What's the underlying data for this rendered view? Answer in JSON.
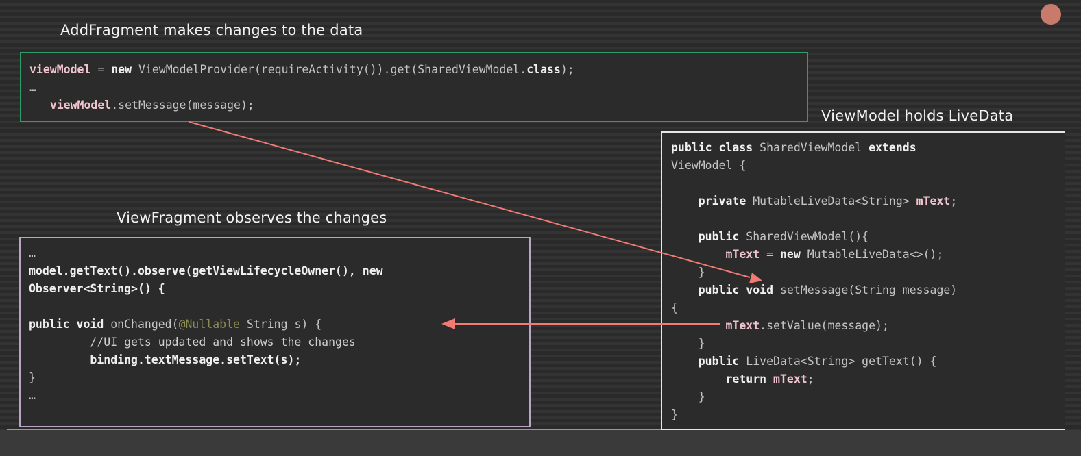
{
  "captions": {
    "add": "AddFragment makes changes to the data",
    "viewmodel": "ViewModel holds LiveData",
    "view": "ViewFragment observes the changes"
  },
  "colors": {
    "add_box_border": "#2e9e68",
    "view_box_border": "#b9a6c4",
    "vm_box_border": "#e6e6e6",
    "arrow": "#f07a74",
    "identifier": "#f2c4cf",
    "annotation": "#8b8b52",
    "corner_mark": "#c97b6b"
  },
  "icons": {
    "arrow_head": "arrowhead-icon",
    "corner": "circle-icon"
  },
  "add_code": [
    [
      {
        "t": "viewModel",
        "c": "id"
      },
      {
        "t": " = ",
        "c": "tx"
      },
      {
        "t": "new",
        "c": "kw"
      },
      {
        "t": " ViewModelProvider(requireActivity()).get(SharedViewModel.",
        "c": "tx"
      },
      {
        "t": "class",
        "c": "kw"
      },
      {
        "t": ");",
        "c": "tx"
      }
    ],
    [
      {
        "t": "…",
        "c": "tx"
      }
    ],
    [
      {
        "t": "   ",
        "c": "tx"
      },
      {
        "t": "viewModel",
        "c": "id"
      },
      {
        "t": ".setMessage(message);",
        "c": "tx"
      }
    ]
  ],
  "viewmodel_code": [
    [
      {
        "t": "public class",
        "c": "kw"
      },
      {
        "t": " SharedViewModel ",
        "c": "tx"
      },
      {
        "t": "extends",
        "c": "kw"
      }
    ],
    [
      {
        "t": "ViewModel {",
        "c": "tx"
      }
    ],
    [
      {
        "t": "",
        "c": "tx"
      }
    ],
    [
      {
        "t": "    ",
        "c": "tx"
      },
      {
        "t": "private",
        "c": "kw"
      },
      {
        "t": " MutableLiveData<String> ",
        "c": "tx"
      },
      {
        "t": "mText",
        "c": "id"
      },
      {
        "t": ";",
        "c": "tx"
      }
    ],
    [
      {
        "t": "",
        "c": "tx"
      }
    ],
    [
      {
        "t": "    ",
        "c": "tx"
      },
      {
        "t": "public",
        "c": "kw"
      },
      {
        "t": " SharedViewModel(){",
        "c": "tx"
      }
    ],
    [
      {
        "t": "        ",
        "c": "tx"
      },
      {
        "t": "mText",
        "c": "id"
      },
      {
        "t": " = ",
        "c": "tx"
      },
      {
        "t": "new",
        "c": "kw"
      },
      {
        "t": " MutableLiveData<>();",
        "c": "tx"
      }
    ],
    [
      {
        "t": "    }",
        "c": "tx"
      }
    ],
    [
      {
        "t": "    ",
        "c": "tx"
      },
      {
        "t": "public void",
        "c": "kw"
      },
      {
        "t": " setMessage(String message)",
        "c": "tx"
      }
    ],
    [
      {
        "t": "{",
        "c": "tx"
      }
    ],
    [
      {
        "t": "        ",
        "c": "tx"
      },
      {
        "t": "mText",
        "c": "id"
      },
      {
        "t": ".setValue(message);",
        "c": "tx"
      }
    ],
    [
      {
        "t": "    }",
        "c": "tx"
      }
    ],
    [
      {
        "t": "    ",
        "c": "tx"
      },
      {
        "t": "public",
        "c": "kw"
      },
      {
        "t": " LiveData<String> getText() {",
        "c": "tx"
      }
    ],
    [
      {
        "t": "        ",
        "c": "tx"
      },
      {
        "t": "return",
        "c": "kw"
      },
      {
        "t": " ",
        "c": "tx"
      },
      {
        "t": "mText",
        "c": "id"
      },
      {
        "t": ";",
        "c": "tx"
      }
    ],
    [
      {
        "t": "    }",
        "c": "tx"
      }
    ],
    [
      {
        "t": "}",
        "c": "tx"
      }
    ]
  ],
  "view_code": [
    [
      {
        "t": "…",
        "c": "tx"
      }
    ],
    [
      {
        "t": "model.getText().observe(getViewLifecycleOwner(), new",
        "c": "kw"
      }
    ],
    [
      {
        "t": "Observer<String>() {",
        "c": "kw"
      }
    ],
    [
      {
        "t": "",
        "c": "tx"
      }
    ],
    [
      {
        "t": "public void",
        "c": "kw"
      },
      {
        "t": " onChanged(",
        "c": "tx"
      },
      {
        "t": "@Nullable",
        "c": "an"
      },
      {
        "t": " String s) {",
        "c": "tx"
      }
    ],
    [
      {
        "t": "         //UI gets updated and shows the changes",
        "c": "cm"
      }
    ],
    [
      {
        "t": "         ",
        "c": "tx"
      },
      {
        "t": "binding.textMessage.setText(s);",
        "c": "kw"
      }
    ],
    [
      {
        "t": "}",
        "c": "tx"
      }
    ],
    [
      {
        "t": "…",
        "c": "tx"
      }
    ]
  ]
}
